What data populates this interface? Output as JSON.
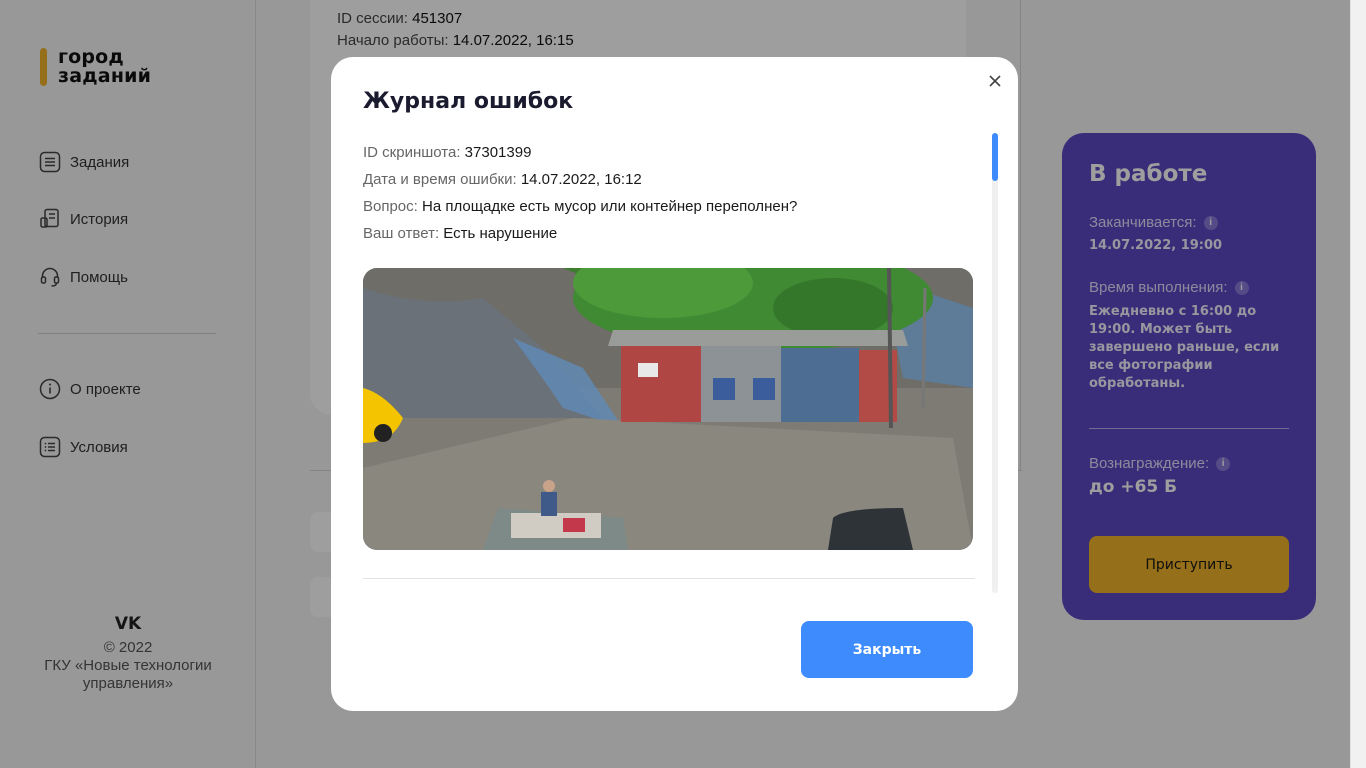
{
  "app": {
    "logo_line1": "город",
    "logo_line2": "заданий",
    "accent_color": "#f0b429"
  },
  "sidebar": {
    "items": [
      {
        "label": "Задания",
        "icon": "tasks-list-icon"
      },
      {
        "label": "История",
        "icon": "history-doc-icon"
      },
      {
        "label": "Помощь",
        "icon": "headset-icon"
      },
      {
        "label": "О проекте",
        "icon": "info-circle-icon"
      },
      {
        "label": "Условия",
        "icon": "terms-list-icon"
      }
    ],
    "footer": {
      "social_icon": "vk-icon",
      "social_label": "VK",
      "copyright": "© 2022",
      "org": "ГКУ «Новые технологии управления»"
    }
  },
  "background": {
    "session_id_label": "ID сессии:",
    "session_id": "451307",
    "start_label": "Начало работы:",
    "start_value": "14.07.2022, 16:15"
  },
  "panel": {
    "title": "В работе",
    "ends_label": "Заканчивается:",
    "ends_value": "14.07.2022, 19:00",
    "time_label": "Время выполнения:",
    "time_value": "Ежедневно с 16:00 до 19:00. Может быть завершено раньше, если все фотографии обработаны.",
    "reward_label": "Вознаграждение:",
    "reward_value": "до +65 Б",
    "start_button": "Приступить",
    "bg_color": "#5c48c4"
  },
  "modal": {
    "title": "Журнал ошибок",
    "close_icon": "close-icon",
    "fields": [
      {
        "label": "ID скриншота:",
        "value": "37301399"
      },
      {
        "label": "Дата и время ошибки:",
        "value": "14.07.2022, 16:12"
      },
      {
        "label": "Вопрос:",
        "value": "На площадке есть мусор или контейнер переполнен?"
      },
      {
        "label": "Ваш ответ:",
        "value": "Есть нарушение"
      }
    ],
    "close_button": "Закрыть",
    "button_color": "#3d8bfd"
  }
}
